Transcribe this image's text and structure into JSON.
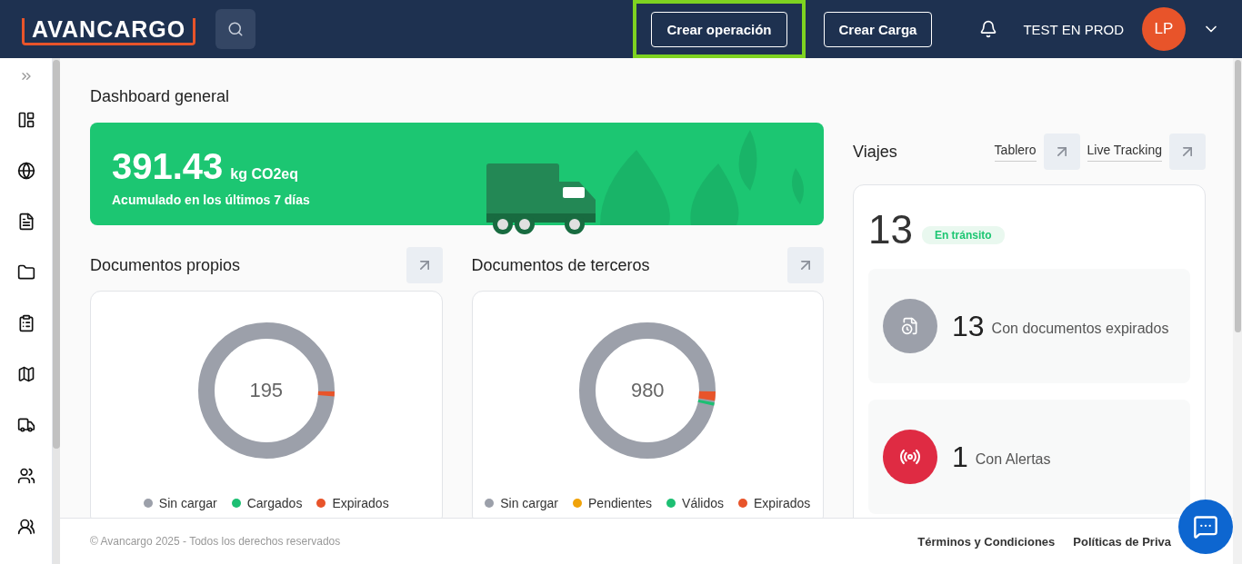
{
  "header": {
    "logo": "AVANCARGO",
    "buttons": [
      {
        "label": "Crear operación",
        "highlighted": true
      },
      {
        "label": "Crear Carga",
        "highlighted": false
      }
    ],
    "user": "TEST EN PROD",
    "avatar": "LP"
  },
  "page_title": "Dashboard general",
  "emissions": {
    "value": "391.43",
    "unit": "kg CO2eq",
    "caption": "Acumulado en los últimos 7 días"
  },
  "documents": [
    {
      "title": "Documentos propios",
      "total": "195",
      "legend": [
        {
          "label": "Sin cargar",
          "color": "#9ca0aa"
        },
        {
          "label": "Cargados",
          "color": "#1dbf73"
        },
        {
          "label": "Expirados",
          "color": "#e8542a"
        }
      ]
    },
    {
      "title": "Documentos de terceros",
      "total": "980",
      "legend": [
        {
          "label": "Sin cargar",
          "color": "#9ca0aa"
        },
        {
          "label": "Pendientes",
          "color": "#f0a30a"
        },
        {
          "label": "Válidos",
          "color": "#1dbf73"
        },
        {
          "label": "Expirados",
          "color": "#e8542a"
        }
      ]
    }
  ],
  "trips": {
    "title": "Viajes",
    "links": [
      "Tablero",
      "Live Tracking"
    ],
    "count": "13",
    "status": "En tránsito",
    "stats": [
      {
        "kind": "documents",
        "value": "13",
        "label": "Con documentos expirados"
      },
      {
        "kind": "alerts",
        "value": "1",
        "label": "Con Alertas"
      }
    ]
  },
  "footer": {
    "copyright": "© Avancargo 2025 - Todos los derechos reservados",
    "links": [
      "Términos y Condiciones",
      "Políticas de Priva"
    ]
  }
}
